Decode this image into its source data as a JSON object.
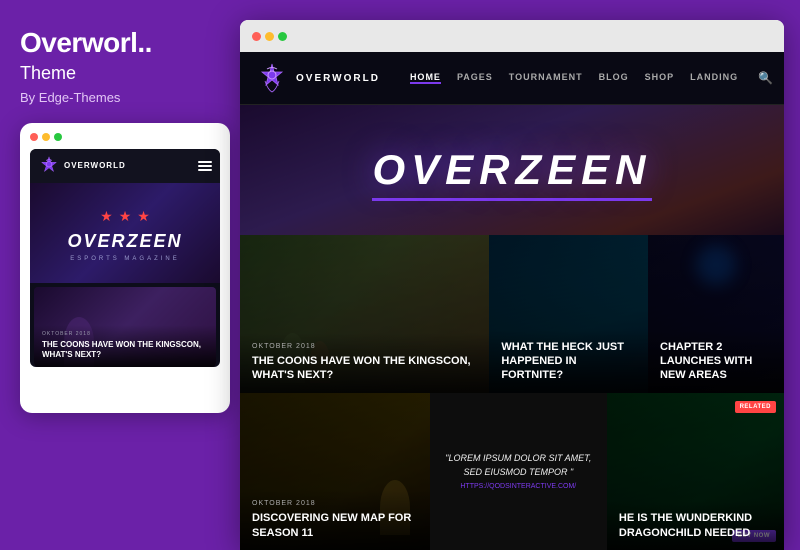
{
  "left": {
    "title": "Overworl..",
    "subtitle": "Theme",
    "author": "By Edge-Themes",
    "dots": [
      "red",
      "yellow",
      "green"
    ],
    "mobile": {
      "logo_text": "OVERWORLD",
      "stars": [
        "★",
        "★",
        "★"
      ],
      "hero_title": "OVERZEEN",
      "hero_sub": "ESPORTS MAGAZINE",
      "card": {
        "meta": "OKTOBER 2018",
        "title": "THE COONS HAVE WON THE KINGSCON, WHAT'S NEXT?"
      }
    }
  },
  "browser": {
    "dots": [
      "red",
      "yellow",
      "green"
    ],
    "nav": {
      "logo_text": "OVERWORLD",
      "links": [
        "HOME",
        "PAGES",
        "TOURNAMENT",
        "BLOG",
        "SHOP",
        "LANDING"
      ],
      "active_link": "HOME"
    },
    "hero": {
      "title": "OVERZEEN"
    },
    "cards_row1": [
      {
        "meta": "OKTOBER 2018",
        "title": "THE COONS HAVE WON THE KINGSCON, WHAT'S NEXT?"
      },
      {
        "meta": "",
        "title": "WHAT THE HECK JUST HAPPENED IN FORTNITE?"
      },
      {
        "meta": "",
        "title": "CHAPTER 2 LAUNCHES WITH NEW AREAS"
      }
    ],
    "cards_row2": [
      {
        "meta": "OKTOBER 2018",
        "title": "DISCOVERING NEW MAP FOR SEASON 11"
      },
      {
        "quote": "\"LOREM IPSUM DOLOR SIT AMET, SED EIUSMOD TEMPOR \"",
        "url": "HTTPS://QODSINTERACTIVE.COM/"
      },
      {
        "meta": "",
        "title": "HE IS THE WUNDERKIND DRAGONCHILD NEEDED"
      }
    ],
    "related_label": "RELATED",
    "buy_now_label": "BUY NOW"
  }
}
